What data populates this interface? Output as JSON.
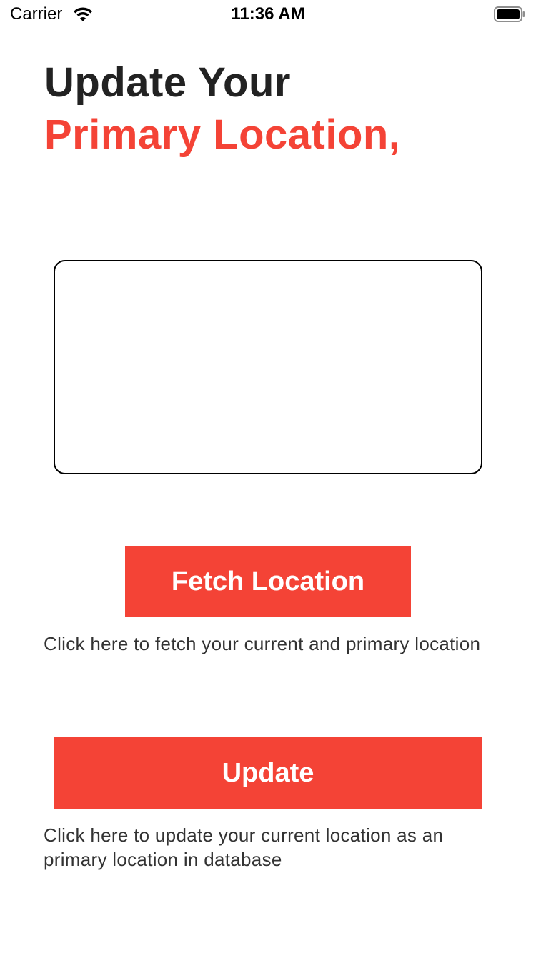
{
  "status_bar": {
    "carrier": "Carrier",
    "time": "11:36 AM",
    "wifi_icon": "wifi-icon",
    "battery_icon": "battery-icon"
  },
  "heading": {
    "line1": "Update Your",
    "line2": "Primary Location,"
  },
  "location_box": {
    "content": ""
  },
  "fetch": {
    "button_label": "Fetch Location",
    "help_text": "Click here to fetch your current and primary location"
  },
  "update": {
    "button_label": "Update",
    "help_text": "Click here to update your current location as an primary location in database"
  },
  "colors": {
    "accent": "#F44336",
    "text": "#222222"
  }
}
